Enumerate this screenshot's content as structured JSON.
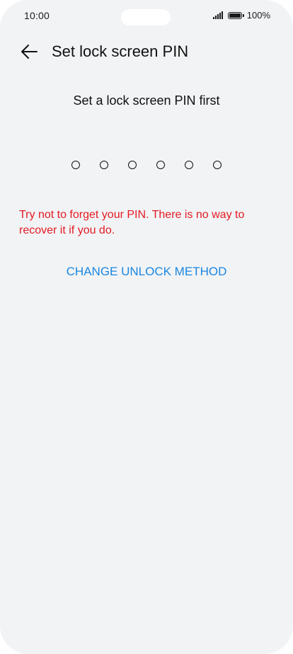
{
  "status_bar": {
    "time": "10:00",
    "battery_text": "100%",
    "signal_icon": "signal-icon",
    "battery_icon": "battery-icon"
  },
  "header": {
    "back_icon": "arrow-left-icon",
    "title": "Set lock screen PIN"
  },
  "main": {
    "instruction": "Set a lock screen PIN first",
    "pin_length": 6,
    "warning": "Try not to forget your PIN. There is no way to recover it if you do.",
    "change_method_label": "CHANGE UNLOCK METHOD"
  },
  "colors": {
    "warning": "#e31b23",
    "link": "#1b86e0",
    "background": "#f1f3f5"
  }
}
